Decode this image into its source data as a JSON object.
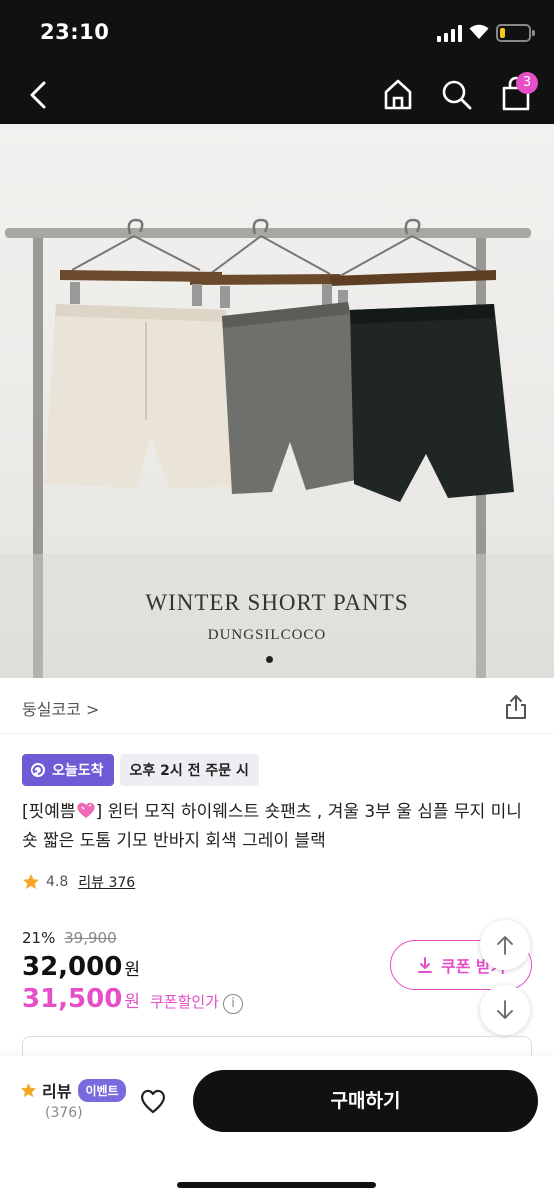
{
  "status": {
    "time": "23:10",
    "battery_level": 0.2,
    "battery_color": "#f5c518"
  },
  "nav": {
    "cart_count": "3",
    "back_icon": "chevron-left-icon",
    "home_icon": "home-icon",
    "search_icon": "search-icon",
    "cart_icon": "shopping-bag-icon",
    "badge_color": "#e64fc8"
  },
  "hero": {
    "caption_line1": "WINTER SHORT PANTS",
    "caption_line2": "DUNGSILCOCO",
    "page_count": 1,
    "current_page": 1
  },
  "seller": {
    "name": "둥실코코 >"
  },
  "delivery": {
    "badge_label": "오늘도착",
    "badge_time": "오후 2시 전 주문 시",
    "badge_color": "#6f5bd6"
  },
  "product": {
    "title_prefix": "[핏예쁨",
    "title_rest": "] 윈터 모직 하이웨스트 숏팬츠 , 겨울 3부 울 심플 무지 미니 숏 짧은 도톰 기모 반바지 회색 그레이 블랙",
    "rating": "4.8",
    "review_label": "리뷰 376"
  },
  "pricing": {
    "discount_rate": "21%",
    "original_price": "39,900",
    "price": "32,000",
    "price_unit": "원",
    "coupon_price": "31,500",
    "coupon_unit": "원",
    "coupon_label": "쿠폰할인가",
    "coupon_button": "쿠폰 받기",
    "accent_color": "#e64fc8"
  },
  "bottom": {
    "review_label": "리뷰",
    "event_badge": "이벤트",
    "review_count": "(376)",
    "buy_label": "구매하기"
  }
}
